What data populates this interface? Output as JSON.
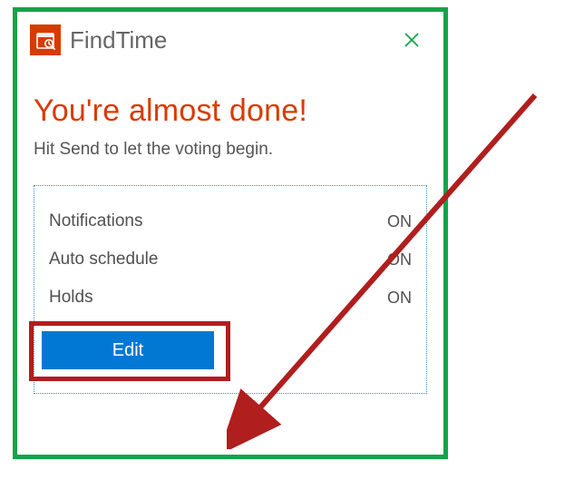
{
  "header": {
    "app_name": "FindTime"
  },
  "main": {
    "heading": "You're almost done!",
    "subheading": "Hit Send to let the voting begin."
  },
  "settings": {
    "rows": [
      {
        "label": "Notifications",
        "value": "ON"
      },
      {
        "label": "Auto schedule",
        "value": "ON"
      },
      {
        "label": "Holds",
        "value": "ON"
      }
    ],
    "edit_label": "Edit"
  },
  "colors": {
    "accent_orange": "#d83b01",
    "accent_blue": "#0078d4",
    "annotation_green": "#12a44a",
    "annotation_red": "#b01e1e"
  }
}
